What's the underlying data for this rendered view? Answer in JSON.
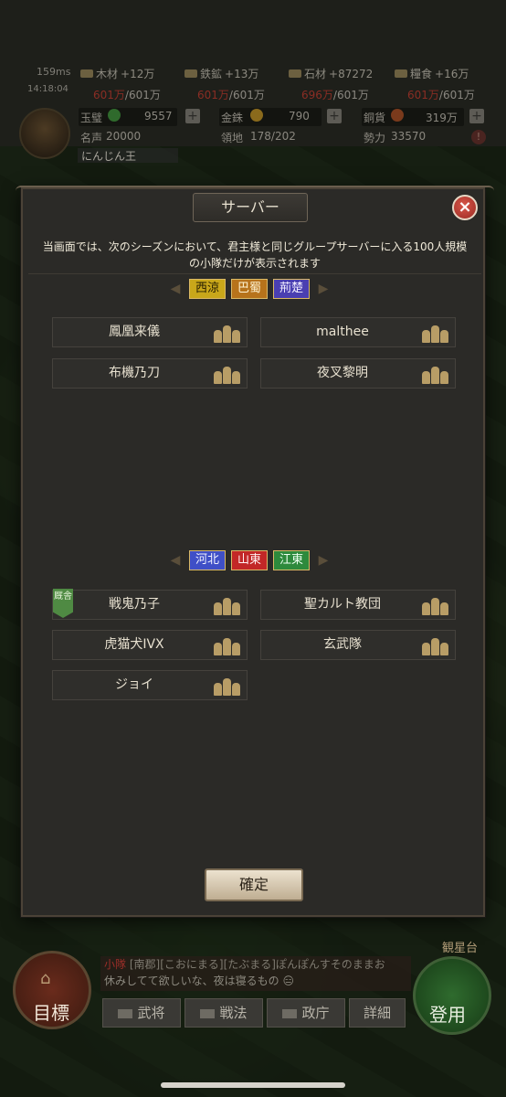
{
  "hud": {
    "signal": "159ms",
    "time": "14:18:04",
    "resources": [
      {
        "name": "木材",
        "rate": "+12万",
        "current": "601万",
        "cap": "601万"
      },
      {
        "name": "鉄鉱",
        "rate": "+13万",
        "current": "601万",
        "cap": "601万"
      },
      {
        "name": "石材",
        "rate": "+87272",
        "current": "696万",
        "cap": "601万"
      },
      {
        "name": "糧食",
        "rate": "+16万",
        "current": "601万",
        "cap": "601万"
      }
    ],
    "stats": {
      "jade_label": "玉璧",
      "jade_value": "9557",
      "gold_label": "金銖",
      "gold_value": "790",
      "copper_label": "銅貨",
      "copper_value": "319万",
      "fame_label": "名声",
      "fame_value": "20000",
      "territory_label": "領地",
      "territory_value": "178/202",
      "power_label": "勢力",
      "power_value": "33570"
    },
    "lord_name": "にんじん王"
  },
  "modal": {
    "title": "サーバー",
    "close_symbol": "×",
    "notice_line1": "当画面では、次のシーズンにおいて、君主様と同じグループサーバーに入る100人規模",
    "notice_line2": "の小隊だけが表示されます",
    "group1": {
      "tags": [
        "西涼",
        "巴蜀",
        "荊楚"
      ],
      "units": [
        "鳳凰来儀",
        "malthee",
        "布機乃刀",
        "夜叉黎明"
      ]
    },
    "group2": {
      "tags": [
        "河北",
        "山東",
        "江東"
      ],
      "units": [
        "戦鬼乃子",
        "聖カルト教団",
        "虎猫犬IVX",
        "玄武隊",
        "ジョイ"
      ],
      "badge": "厩舎"
    },
    "confirm_label": "確定"
  },
  "bottom": {
    "goal_label": "目標",
    "appear_label": "登用",
    "tower_label": "観星台",
    "chat_tag": "小隊",
    "chat_line1": "[南郡][こおにまる][たぶまる]ぽんぽんすそのままお",
    "chat_line2": "休みしてて欲しいな、夜は寝るもの 😑",
    "tabs": [
      "武将",
      "戦法",
      "政庁",
      "詳細"
    ]
  },
  "colors": {
    "modal_bg": "#2b2a27",
    "tag_yellow": "#c9a71a",
    "tag_orange": "#b7731b",
    "tag_purple": "#4a3fb1",
    "tag_blue": "#3f4fc7",
    "tag_red": "#c22727",
    "tag_green": "#2d8a3c",
    "close_red": "#c9473b"
  }
}
